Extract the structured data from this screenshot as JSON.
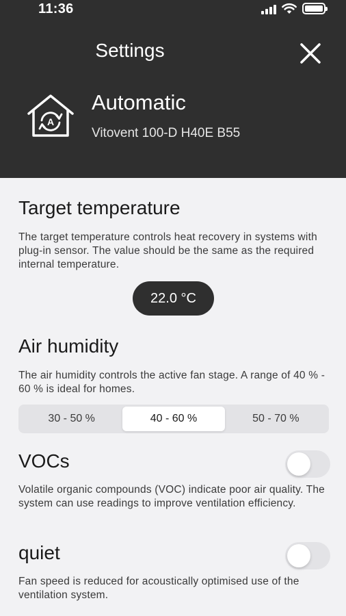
{
  "status": {
    "time": "11:36"
  },
  "header": {
    "title": "Settings",
    "mode_title": "Automatic",
    "device": "Vitovent 100-D H40E B55",
    "mode_icon_letter": "A"
  },
  "target_temperature": {
    "title": "Target temperature",
    "description": "The target temperature controls heat recovery in systems with plug-in sensor. The value should be the same as the required internal temperature.",
    "value": "22.0 °C"
  },
  "air_humidity": {
    "title": "Air humidity",
    "description": "The air humidity controls the active fan stage. A range of 40 % - 60 % is ideal for homes.",
    "options": [
      "30 - 50 %",
      "40 - 60 %",
      "50 - 70 %"
    ],
    "selected": "40 - 60 %"
  },
  "vocs": {
    "title": "VOCs",
    "description": "Volatile organic compounds (VOC) indicate poor air quality. The system can use readings to improve ventilation efficiency.",
    "enabled": false
  },
  "quiet": {
    "title": "quiet",
    "description": "Fan speed is reduced for acoustically optimised use of the ventilation system.",
    "enabled": false
  }
}
